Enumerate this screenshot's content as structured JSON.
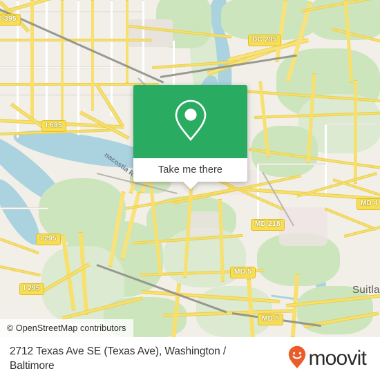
{
  "map": {
    "attribution": "© OpenStreetMap contributors",
    "place_labels": [
      {
        "name": "suitland-label",
        "text": "Suitlan"
      }
    ],
    "water_labels": [
      {
        "name": "anacostia-river-label",
        "text": "nacostia Ri"
      }
    ],
    "highway_shields": [
      {
        "name": "shield-i-395",
        "text": "I 395"
      },
      {
        "name": "shield-dc-295",
        "text": "DC 295"
      },
      {
        "name": "shield-i-695",
        "text": "I 695"
      },
      {
        "name": "shield-i-295-north",
        "text": "I 295"
      },
      {
        "name": "shield-i-295-south",
        "text": "I 295"
      },
      {
        "name": "shield-md-218",
        "text": "MD 218"
      },
      {
        "name": "shield-md-4",
        "text": "MD 4"
      },
      {
        "name": "shield-md-5-west",
        "text": "MD 5"
      },
      {
        "name": "shield-md-5-south",
        "text": "MD 5"
      }
    ],
    "colors": {
      "land": "#f2efe9",
      "park": "#cde5bd",
      "water": "#aad3df",
      "road": "#f7e06e",
      "shield_fill": "#f7de55"
    }
  },
  "popup": {
    "icon": "map-pin-icon",
    "action_label": "Take me there",
    "accent_color": "#2aab62"
  },
  "footer": {
    "title": "2712 Texas Ave SE (Texas Ave), Washington / Baltimore",
    "brand": {
      "name": "moovit",
      "icon": "moovit-smiling-pin-icon",
      "color": "#ec5c2b"
    }
  }
}
